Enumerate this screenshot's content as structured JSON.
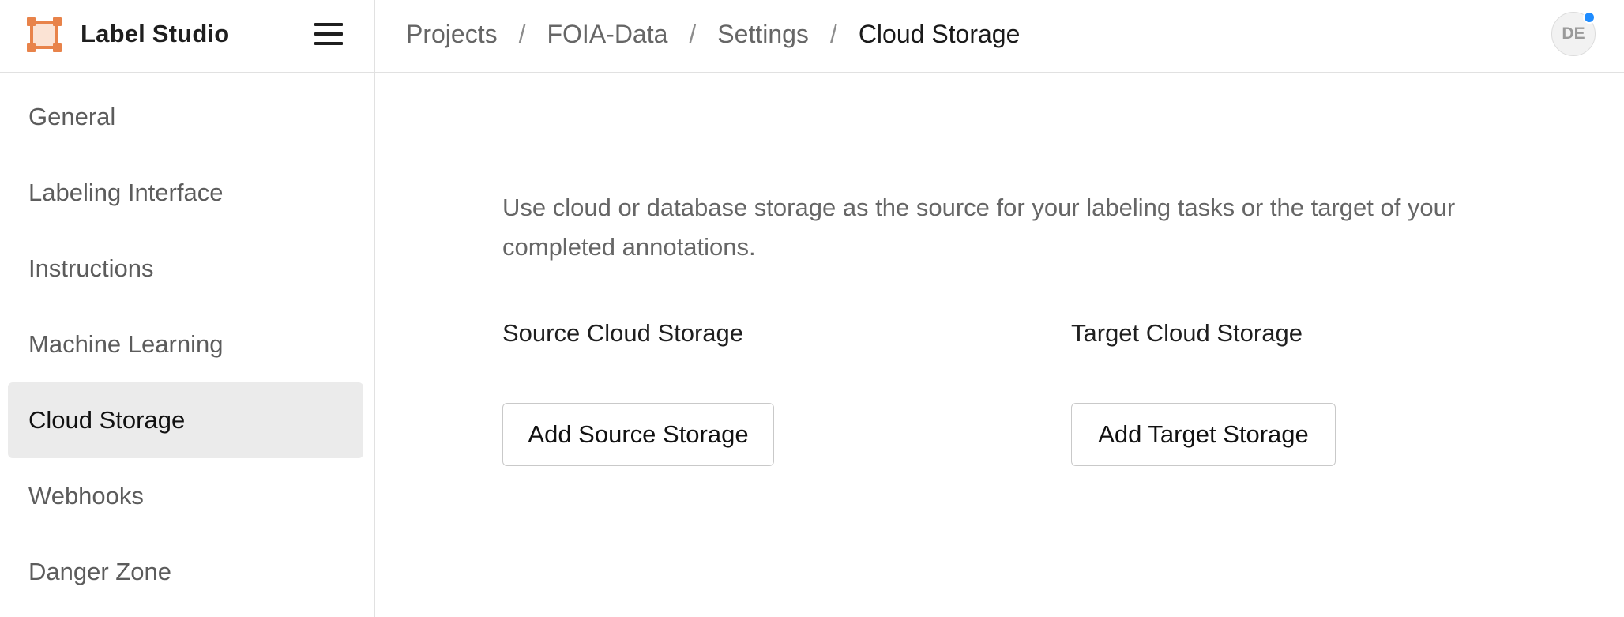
{
  "app": {
    "name": "Label Studio",
    "avatar_initials": "DE",
    "brand_color": "#e8834a",
    "notification_color": "#1f8cff"
  },
  "breadcrumb": {
    "items": [
      "Projects",
      "FOIA-Data",
      "Settings",
      "Cloud Storage"
    ],
    "separator": "/"
  },
  "sidebar": {
    "active": "Cloud Storage",
    "items": [
      {
        "label": "General"
      },
      {
        "label": "Labeling Interface"
      },
      {
        "label": "Instructions"
      },
      {
        "label": "Machine Learning"
      },
      {
        "label": "Cloud Storage"
      },
      {
        "label": "Webhooks"
      },
      {
        "label": "Danger Zone"
      }
    ]
  },
  "main": {
    "description": "Use cloud or database storage as the source for your labeling tasks or the target of your completed annotations.",
    "source": {
      "title": "Source Cloud Storage",
      "button_label": "Add Source Storage"
    },
    "target": {
      "title": "Target Cloud Storage",
      "button_label": "Add Target Storage"
    }
  },
  "icons": {
    "logo": "label-studio-logo-icon",
    "menu": "hamburger-menu-icon"
  }
}
